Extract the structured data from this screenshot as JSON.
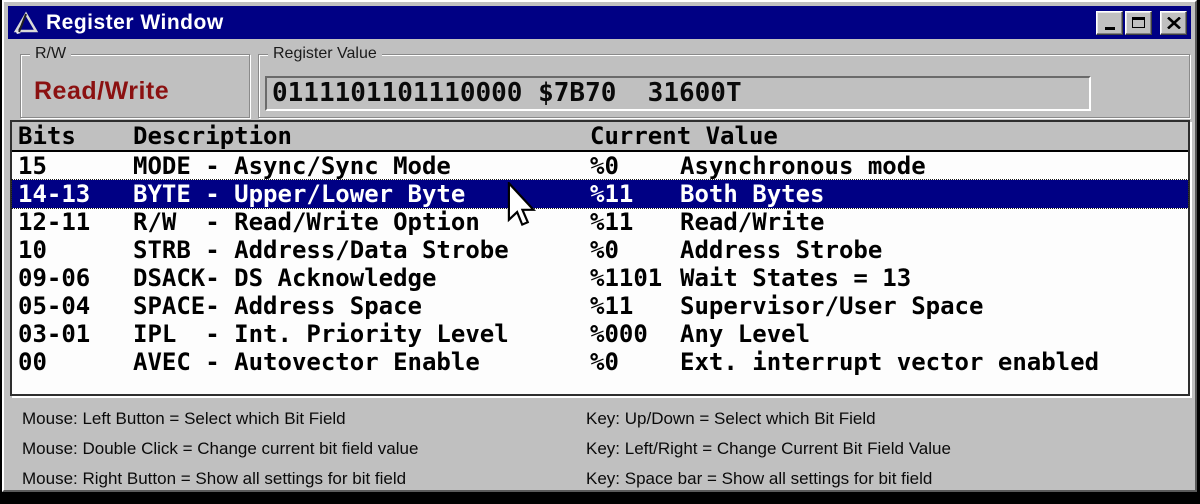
{
  "window": {
    "title": "Register Window"
  },
  "rw_group": {
    "label": "R/W",
    "value": "Read/Write"
  },
  "register_value_group": {
    "label": "Register Value",
    "value": "0111101101110000 $7B70  31600T"
  },
  "table": {
    "headers": {
      "bits": "Bits",
      "description": "Description",
      "current_value": "Current Value"
    },
    "rows": [
      {
        "bits": "15",
        "description": "MODE - Async/Sync Mode",
        "value": "%0",
        "meaning": "Asynchronous mode",
        "selected": false
      },
      {
        "bits": "14-13",
        "description": "BYTE - Upper/Lower Byte",
        "value": "%11",
        "meaning": "Both Bytes",
        "selected": true
      },
      {
        "bits": "12-11",
        "description": "R/W  - Read/Write Option",
        "value": "%11",
        "meaning": "Read/Write",
        "selected": false
      },
      {
        "bits": "10",
        "description": "STRB - Address/Data Strobe",
        "value": "%0",
        "meaning": "Address Strobe",
        "selected": false
      },
      {
        "bits": "09-06",
        "description": "DSACK- DS Acknowledge",
        "value": "%1101",
        "meaning": "Wait States = 13",
        "selected": false
      },
      {
        "bits": "05-04",
        "description": "SPACE- Address Space",
        "value": "%11",
        "meaning": "Supervisor/User Space",
        "selected": false
      },
      {
        "bits": "03-01",
        "description": "IPL  - Int. Priority Level",
        "value": "%000",
        "meaning": "Any Level",
        "selected": false
      },
      {
        "bits": "00",
        "description": "AVEC - Autovector Enable",
        "value": "%0",
        "meaning": "Ext. interrupt vector enabled",
        "selected": false
      }
    ]
  },
  "help": {
    "mouse": [
      "Mouse: Left Button = Select which Bit Field",
      "Mouse: Double Click = Change current bit field value",
      "Mouse: Right Button = Show all settings for bit field"
    ],
    "keys": [
      "Key: Up/Down = Select which Bit Field",
      "Key: Left/Right = Change Current Bit Field Value",
      "Key: Space bar = Show all settings for bit field"
    ]
  },
  "colors": {
    "titlebar": "#000084",
    "selection": "#000084",
    "window_grey": "#c0c0c0",
    "rw_text": "#8b1111",
    "list_bg": "#fdfdfd"
  }
}
